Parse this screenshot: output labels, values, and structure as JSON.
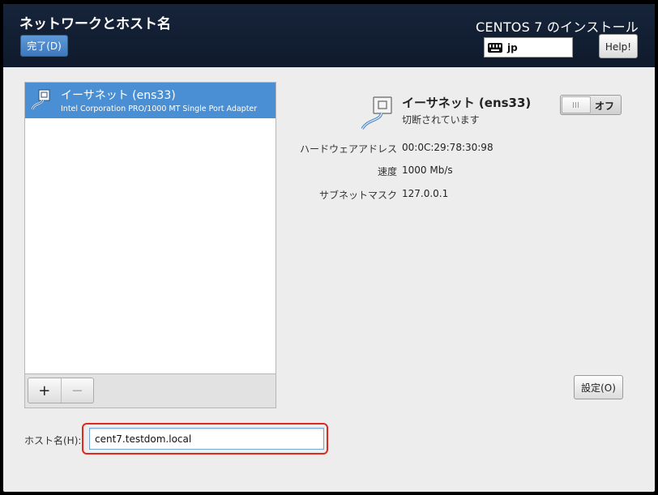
{
  "header": {
    "title": "ネットワークとホスト名",
    "done_label": "完了(D)",
    "install_title": "CENTOS 7 のインストール",
    "keyboard_layout": "jp",
    "help_label": "Help!"
  },
  "device_list": {
    "items": [
      {
        "name": "イーサネット (ens33)",
        "description": "Intel Corporation PRO/1000 MT Single Port Adapter",
        "selected": true,
        "icon": "ethernet-cable-icon"
      }
    ],
    "add_label": "+",
    "remove_label": "−"
  },
  "detail": {
    "name": "イーサネット (ens33)",
    "status": "切断されています",
    "toggle_label": "オフ",
    "toggle_on": false,
    "properties": [
      {
        "label": "ハードウェアアドレス",
        "value": "00:0C:29:78:30:98"
      },
      {
        "label": "速度",
        "value": "1000 Mb/s"
      },
      {
        "label": "サブネットマスク",
        "value": "127.0.0.1"
      }
    ],
    "settings_label": "設定(O)"
  },
  "hostname": {
    "label": "ホスト名(H):",
    "value": "cent7.testdom.local"
  },
  "colors": {
    "header_bg": "#0f1a2c",
    "selection": "#4a8fd3",
    "highlight_border": "#e0281e"
  }
}
